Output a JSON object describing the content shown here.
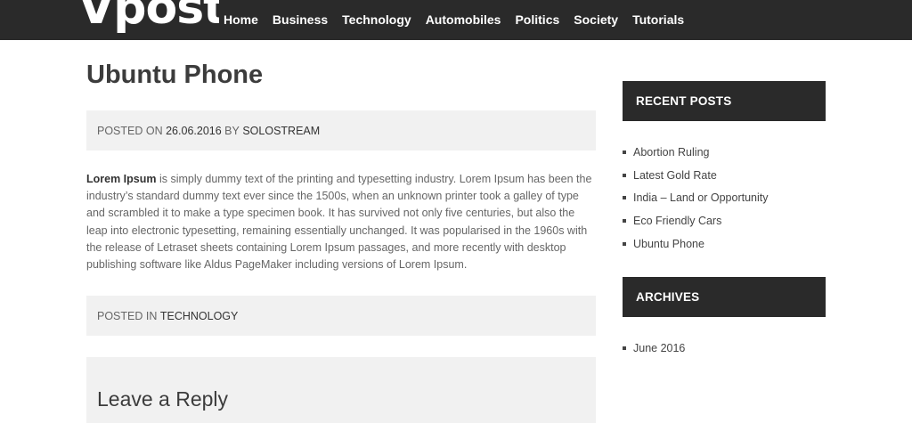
{
  "site": {
    "logo": "Vposts"
  },
  "nav": [
    "Home",
    "Business",
    "Technology",
    "Automobiles",
    "Politics",
    "Society",
    "Tutorials"
  ],
  "post": {
    "title": "Ubuntu Phone",
    "posted_on_label": "POSTED ON",
    "date": "26.06.2016",
    "by_label": "BY",
    "author": "SOLOSTREAM",
    "body_lead": "Lorem Ipsum",
    "body_rest": " is simply dummy text of the printing and typesetting industry. Lorem Ipsum has been the industry’s standard dummy text ever since the 1500s, when an unknown printer took a galley of type and scrambled it to make a type specimen book. It has survived not only five centuries, but also the leap into electronic typesetting, remaining essentially unchanged. It was popularised in the 1960s with the release of Letraset sheets containing Lorem Ipsum passages, and more recently with desktop publishing software like Aldus PageMaker including versions of Lorem Ipsum.",
    "posted_in_label": "POSTED IN",
    "category": "TECHNOLOGY",
    "reply_heading": "Leave a Reply"
  },
  "sidebar": {
    "recent_title": "RECENT POSTS",
    "recent": [
      "Abortion Ruling",
      "Latest Gold Rate",
      "India – Land or Opportunity",
      "Eco Friendly Cars",
      "Ubuntu Phone"
    ],
    "archives_title": "ARCHIVES",
    "archives": [
      "June 2016"
    ]
  },
  "colors": {
    "bar": "#2a2a2a",
    "box": "#f1f1f1",
    "text": "#555555"
  }
}
